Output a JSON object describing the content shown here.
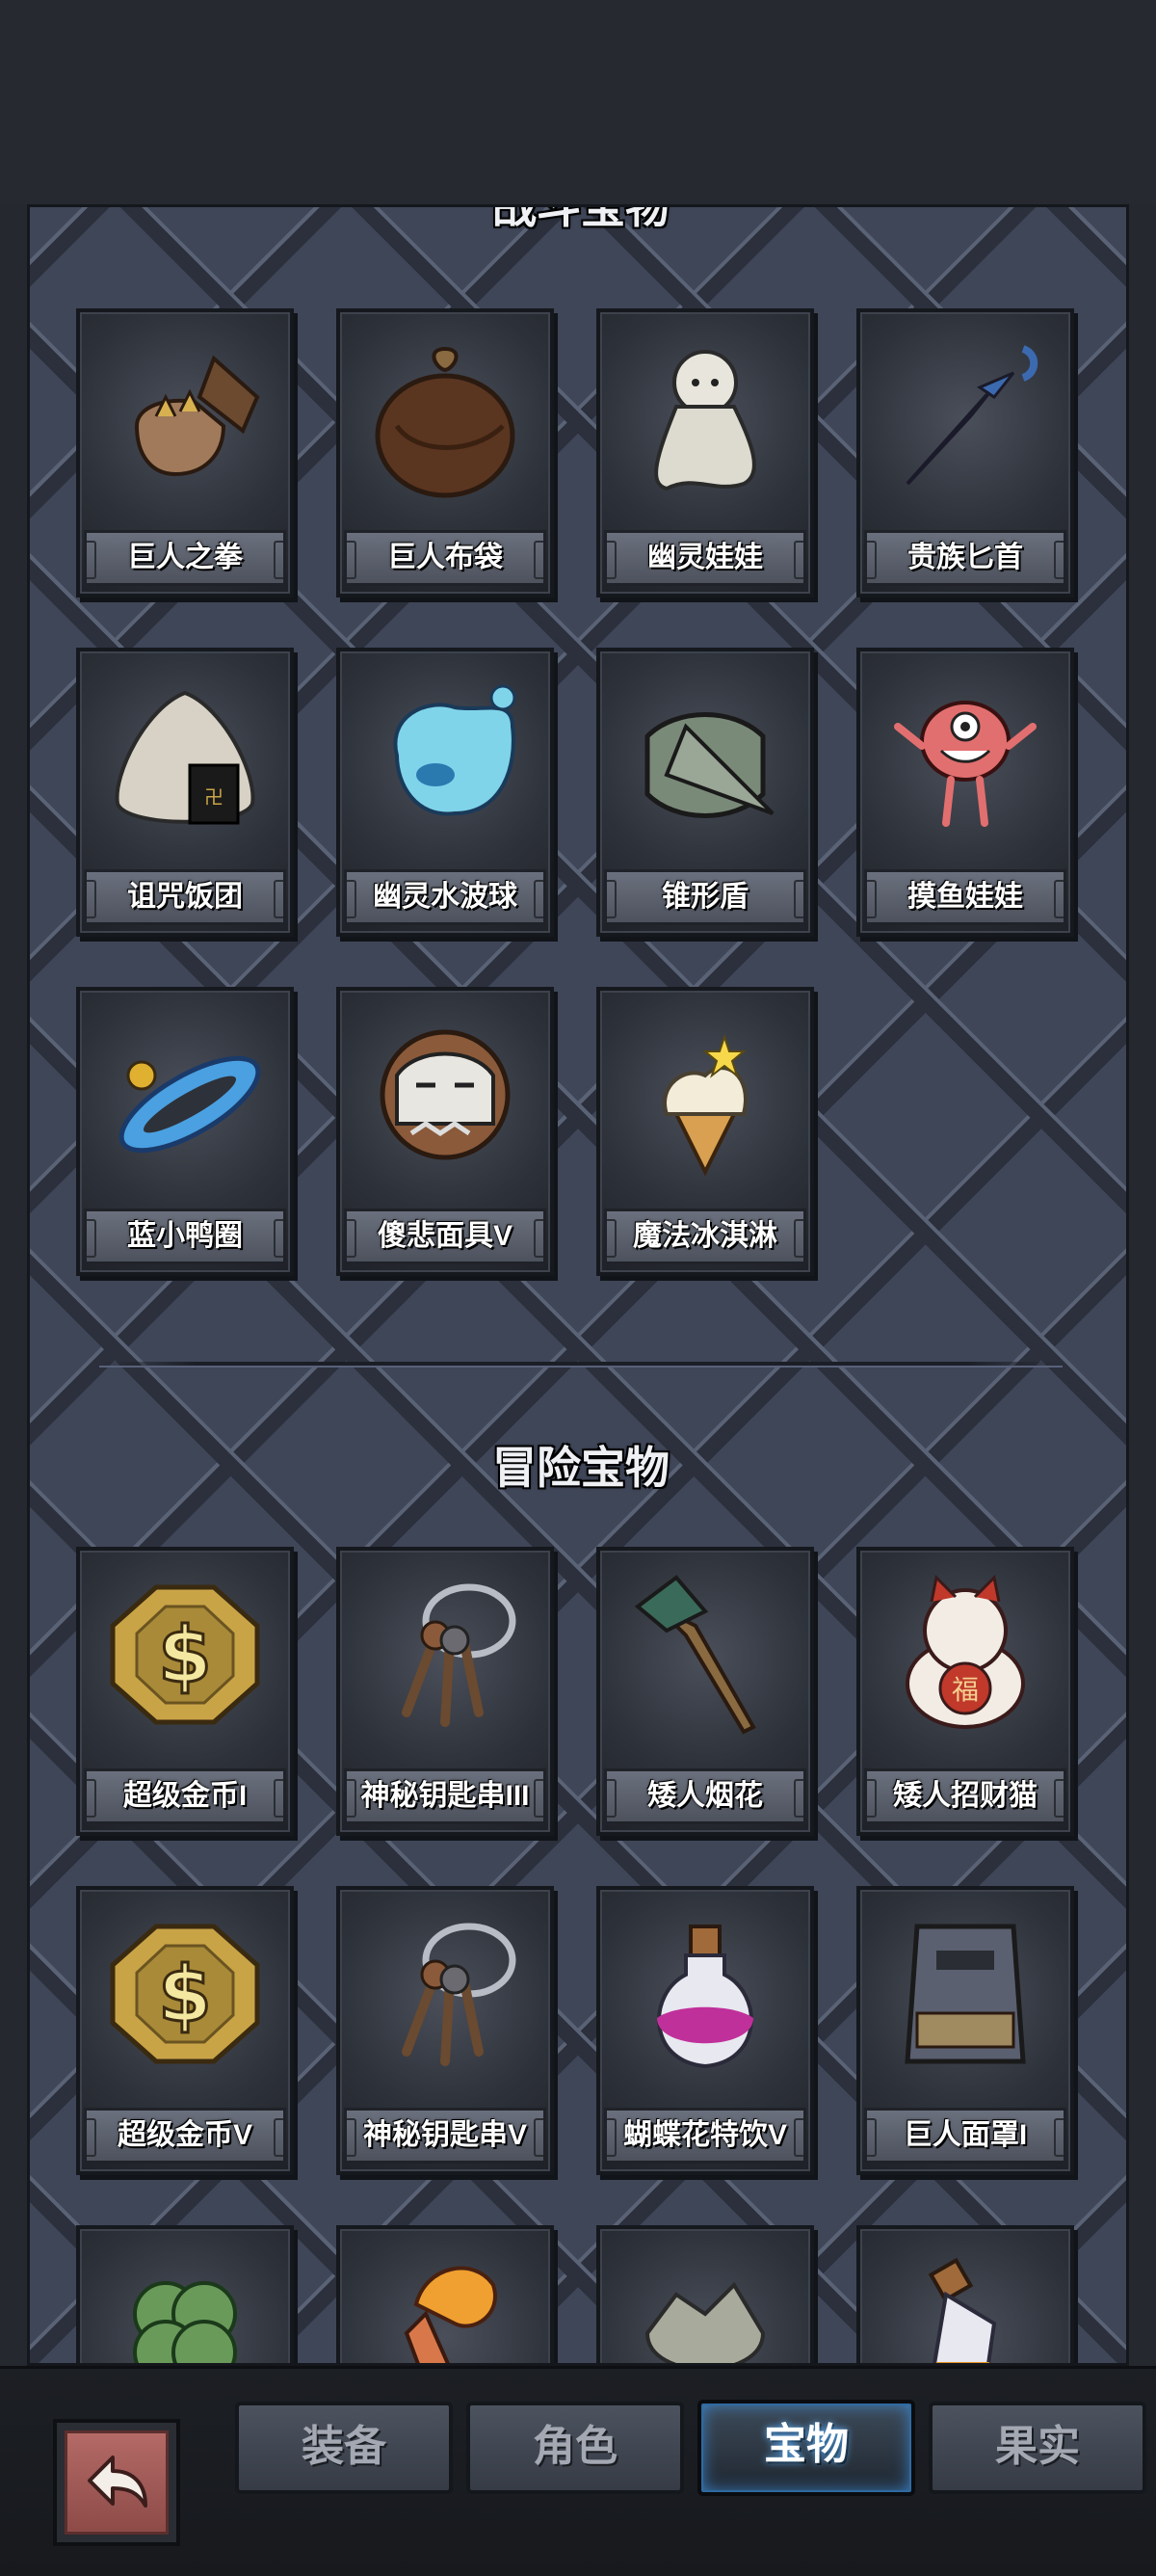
{
  "sections": {
    "battle": {
      "title": "战斗宝物",
      "items": [
        {
          "name": "巨人之拳",
          "icon": "giant-fist-icon"
        },
        {
          "name": "巨人布袋",
          "icon": "giant-sack-icon"
        },
        {
          "name": "幽灵娃娃",
          "icon": "ghost-doll-icon"
        },
        {
          "name": "贵族匕首",
          "icon": "noble-dagger-icon"
        },
        {
          "name": "诅咒饭团",
          "icon": "cursed-riceball-icon"
        },
        {
          "name": "幽灵水波球",
          "icon": "ghost-water-ball-icon"
        },
        {
          "name": "锥形盾",
          "icon": "cone-shield-icon"
        },
        {
          "name": "摸鱼娃娃",
          "icon": "slacker-doll-icon"
        },
        {
          "name": "蓝小鸭圈",
          "icon": "blue-duck-ring-icon"
        },
        {
          "name": "傻悲面具V",
          "icon": "sad-mask-icon"
        },
        {
          "name": "魔法冰淇淋",
          "icon": "magic-icecream-icon"
        }
      ]
    },
    "adventure": {
      "title": "冒险宝物",
      "items": [
        {
          "name": "超级金币I",
          "icon": "gold-coin-icon"
        },
        {
          "name": "神秘钥匙串III",
          "icon": "key-ring-icon"
        },
        {
          "name": "矮人烟花",
          "icon": "dwarf-firework-icon"
        },
        {
          "name": "矮人招财猫",
          "icon": "lucky-cat-icon"
        },
        {
          "name": "超级金币V",
          "icon": "gold-coin-icon"
        },
        {
          "name": "神秘钥匙串V",
          "icon": "key-ring-icon"
        },
        {
          "name": "蝴蝶花特饮V",
          "icon": "potion-flask-icon"
        },
        {
          "name": "巨人面罩I",
          "icon": "giant-mask-icon"
        },
        {
          "name": "",
          "icon": "clover-icon"
        },
        {
          "name": "",
          "icon": "flame-horn-icon"
        },
        {
          "name": "",
          "icon": "broken-egg-icon"
        },
        {
          "name": "",
          "icon": "amber-bottle-icon"
        }
      ]
    }
  },
  "tabs": [
    {
      "label": "装备",
      "active": false
    },
    {
      "label": "角色",
      "active": false
    },
    {
      "label": "宝物",
      "active": true
    },
    {
      "label": "果实",
      "active": false
    }
  ],
  "back_button_icon": "back-arrow-icon",
  "colors": {
    "panel": "#3f4658",
    "card": "#2d3139",
    "back_button": "#a85f5b",
    "active_tab_glow": "#5fb3ff",
    "gold": "#c9a447"
  }
}
